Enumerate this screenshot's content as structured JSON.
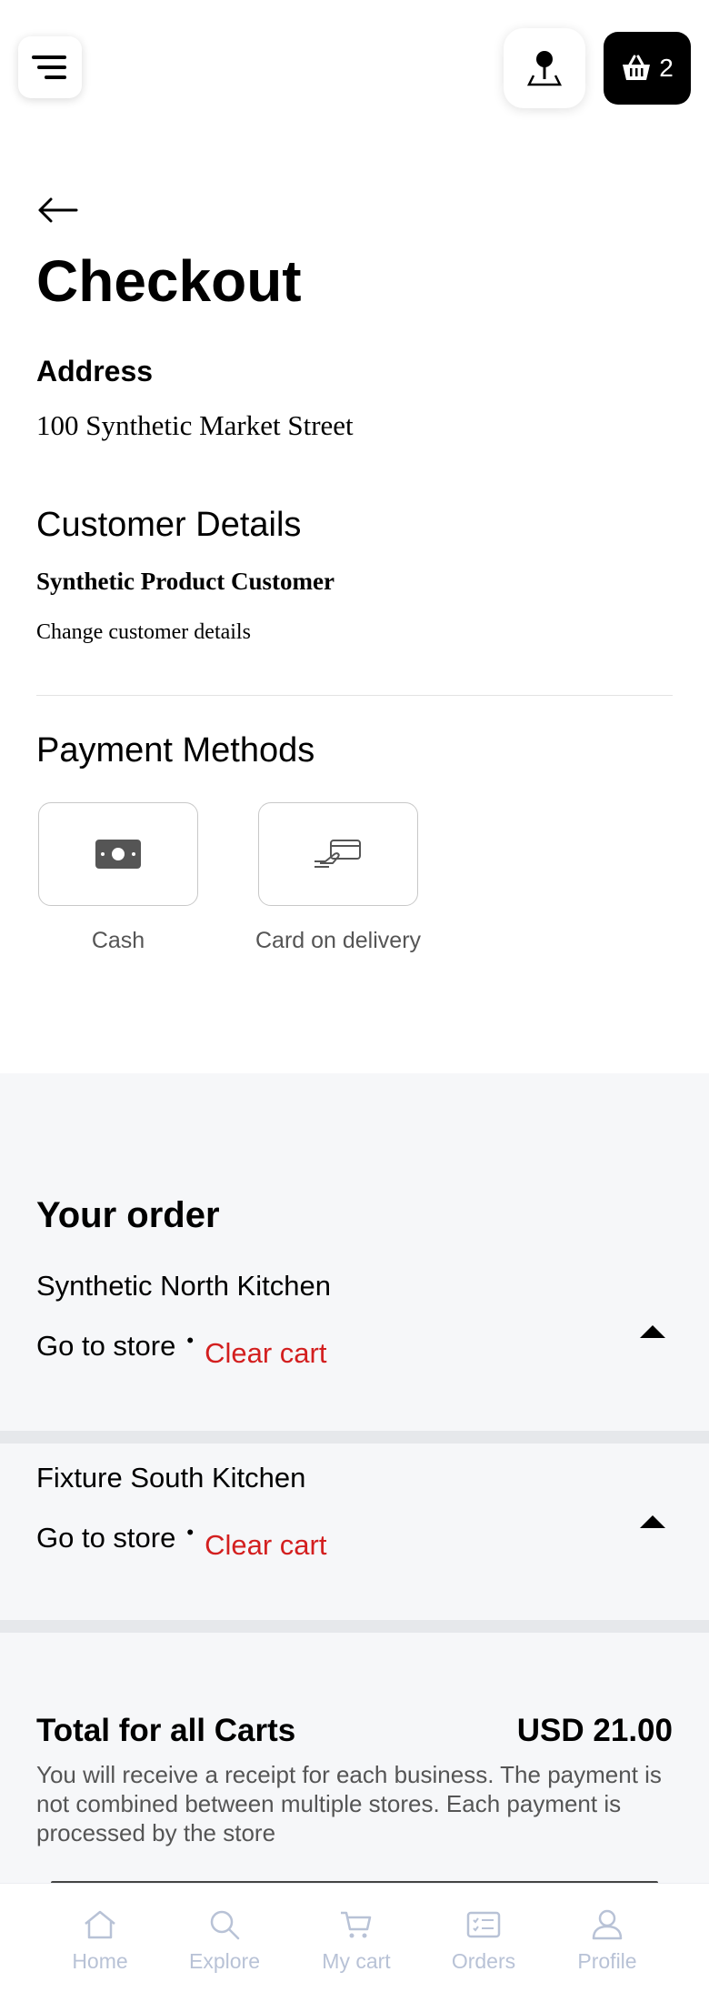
{
  "header": {
    "cart_count": "2"
  },
  "checkout": {
    "title": "Checkout",
    "address_heading": "Address",
    "address_value": "100 Synthetic Market Street",
    "customer_heading": "Customer Details",
    "customer_name": "Synthetic Product Customer",
    "change_customer": "Change customer details",
    "payment_heading": "Payment Methods",
    "payment_methods": [
      {
        "label": "Cash",
        "icon": "cash-icon"
      },
      {
        "label": "Card on delivery",
        "icon": "card-hand-icon"
      }
    ]
  },
  "order": {
    "heading": "Your order",
    "stores": [
      {
        "name": "Synthetic North Kitchen",
        "go_to_store": "Go to store",
        "separator": "•",
        "clear_cart": "Clear cart"
      },
      {
        "name": "Fixture South Kitchen",
        "go_to_store": "Go to store",
        "separator": "•",
        "clear_cart": "Clear cart"
      }
    ]
  },
  "total": {
    "label": "Total for all Carts",
    "value": "USD 21.00",
    "note": "You will receive a receipt for each business. The payment is not combined between multiple stores. Each payment is processed by the store"
  },
  "bottom_nav": [
    {
      "label": "Home",
      "icon": "home-icon"
    },
    {
      "label": "Explore",
      "icon": "search-icon"
    },
    {
      "label": "My cart",
      "icon": "cart-icon"
    },
    {
      "label": "Orders",
      "icon": "orders-icon"
    },
    {
      "label": "Profile",
      "icon": "profile-icon"
    }
  ],
  "colors": {
    "accent_red": "#d31f1f",
    "nav_inactive": "#b8c2d6",
    "section_bg": "#f6f7f9"
  }
}
